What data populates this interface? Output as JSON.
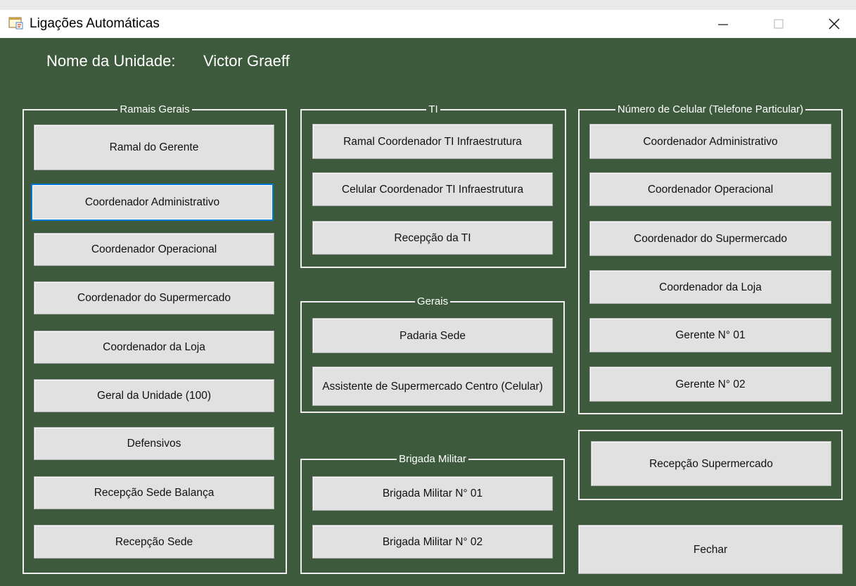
{
  "window": {
    "title": "Ligações Automáticas",
    "background_color": "#3e5a3d",
    "controls": {
      "minimize_icon": "minimize-icon",
      "maximize_icon": "maximize-icon",
      "close_icon": "close-icon"
    }
  },
  "unit": {
    "label": "Nome da Unidade:",
    "value": "Victor Graeff"
  },
  "groups": {
    "ramais_gerais": {
      "title": "Ramais Gerais",
      "buttons": [
        "Ramal do Gerente",
        "Coordenador Administrativo",
        "Coordenador Operacional",
        "Coordenador do Supermercado",
        "Coordenador da Loja",
        "Geral da Unidade (100)",
        "Defensivos",
        "Recepção Sede Balança",
        "Recepção Sede"
      ],
      "focused_button": "Coordenador Administrativo"
    },
    "ti": {
      "title": "TI",
      "buttons": [
        "Ramal Coordenador TI Infraestrutura",
        "Celular Coordenador TI Infraestrutura",
        "Recepção da TI"
      ]
    },
    "gerais": {
      "title": "Gerais",
      "buttons": [
        "Padaria Sede",
        "Assistente de Supermercado Centro (Celular)"
      ]
    },
    "brigada_militar": {
      "title": "Brigada Militar",
      "buttons": [
        "Brigada Militar N° 01",
        "Brigada Militar N° 02"
      ]
    },
    "celular": {
      "title": "Número de Celular (Telefone Particular)",
      "buttons": [
        "Coordenador Administrativo",
        "Coordenador Operacional",
        "Coordenador do Supermercado",
        "Coordenador da Loja",
        "Gerente N° 01",
        "Gerente N° 02"
      ]
    },
    "recepcao_super": {
      "buttons": [
        "Recepção Supermercado"
      ]
    }
  },
  "close_button_label": "Fechar",
  "colors": {
    "focus_border": "#0078d7",
    "button_face": "#e1e1e1",
    "group_border": "#eeeeee"
  }
}
